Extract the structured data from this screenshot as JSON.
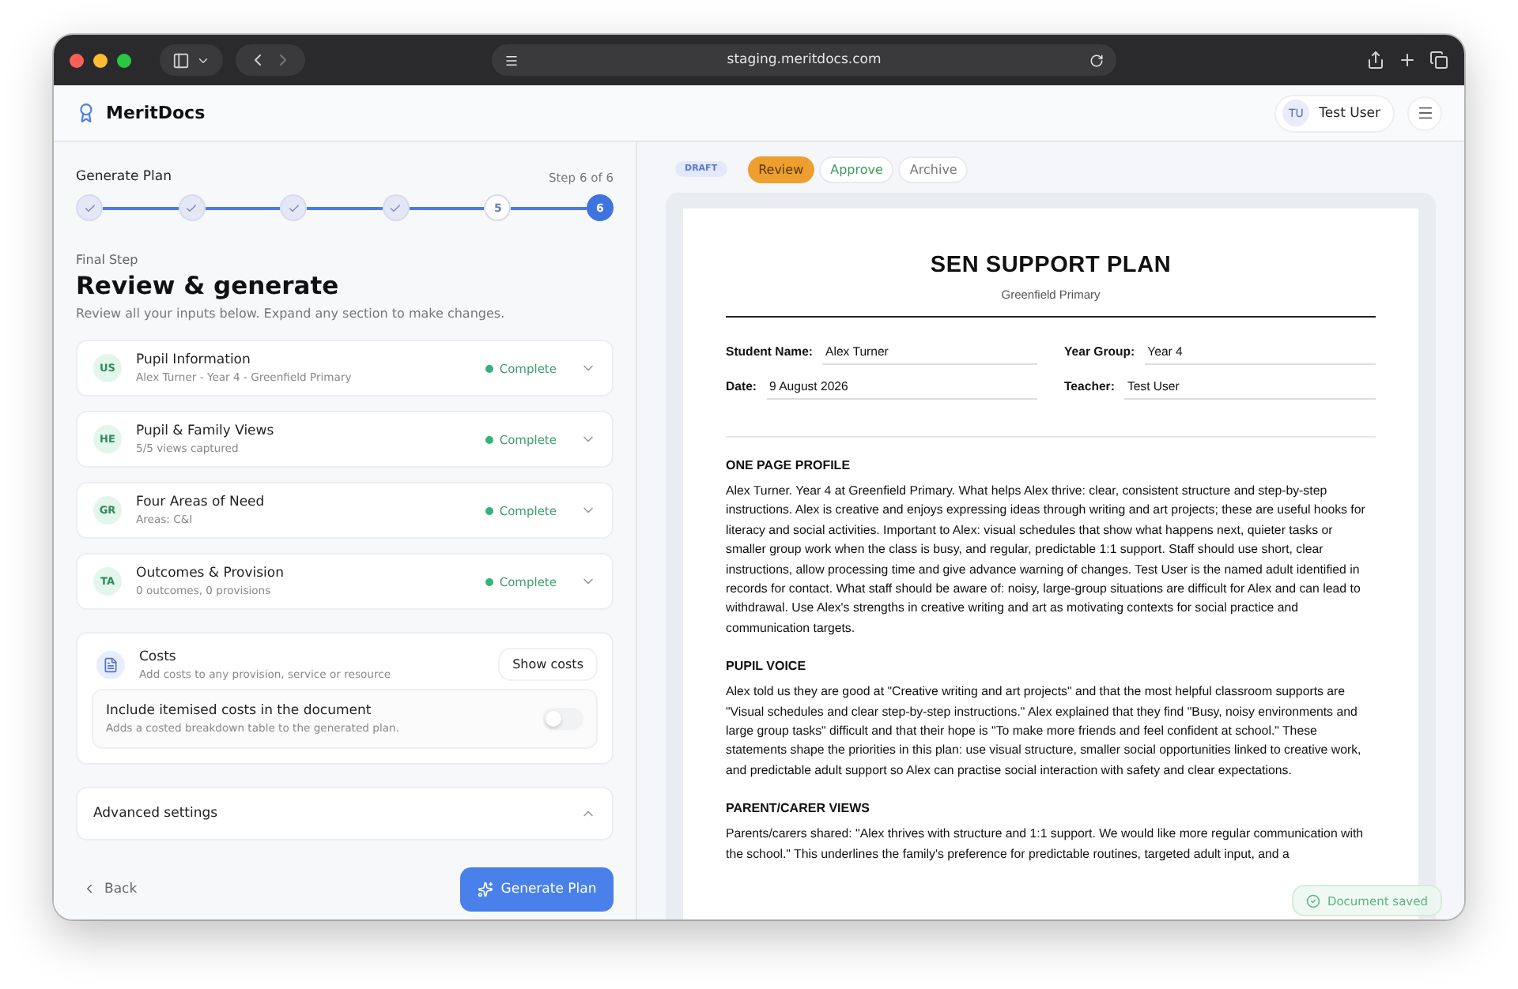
{
  "browser": {
    "url": "staging.meritdocs.com"
  },
  "app": {
    "brand": "MeritDocs",
    "user": {
      "initials": "TU",
      "name": "Test User"
    }
  },
  "wizard": {
    "title": "Generate Plan",
    "step_label": "Step 6 of 6",
    "steps": [
      {
        "done": true,
        "current": false
      },
      {
        "done": true,
        "current": false
      },
      {
        "done": true,
        "current": false
      },
      {
        "done": true,
        "current": false
      },
      {
        "done": false,
        "current": false,
        "label": "5"
      },
      {
        "done": false,
        "current": true,
        "label": "6"
      }
    ],
    "eyebrow": "Final Step",
    "heading": "Review & generate",
    "description": "Review all your inputs below. Expand any section to make changes.",
    "sections": [
      {
        "initials": "US",
        "title": "Pupil Information",
        "subtitle": "Alex Turner - Year 4 - Greenfield Primary",
        "status": "Complete",
        "color": "#34b37a",
        "expanded": false
      },
      {
        "initials": "HE",
        "title": "Pupil & Family Views",
        "subtitle": "5/5 views captured",
        "status": "Complete",
        "color": "#34b37a",
        "expanded": false
      },
      {
        "initials": "GR",
        "title": "Four Areas of Need",
        "subtitle": "Areas: C&I",
        "status": "Complete",
        "color": "#34b37a",
        "expanded": false
      },
      {
        "initials": "TA",
        "title": "Outcomes & Provision",
        "subtitle": "0 outcomes, 0 provisions",
        "status": "Complete",
        "color": "#34b37a",
        "expanded": false
      }
    ],
    "costs": {
      "title": "Costs",
      "subtitle": "Add costs to any provision, service or resource",
      "button": "Show costs",
      "toggle": {
        "title": "Include itemised costs in the document",
        "subtitle": "Adds a costed breakdown table to the generated plan.",
        "on": false
      }
    },
    "advanced": {
      "title": "Advanced settings",
      "expanded": true
    },
    "back": "Back",
    "generate": "Generate Plan"
  },
  "document": {
    "badge": "DRAFT",
    "workflow": [
      {
        "label": "Review",
        "kind": "review",
        "selected": true
      },
      {
        "label": "Approve",
        "kind": "approve",
        "selected": false
      },
      {
        "label": "Archive",
        "kind": "archive",
        "selected": false
      }
    ],
    "title": "SEN SUPPORT PLAN",
    "school": "Greenfield Primary",
    "fields": [
      {
        "label": "Student Name:",
        "value": "Alex Turner"
      },
      {
        "label": "Year Group:",
        "value": "Year 4"
      },
      {
        "label": "Date:",
        "value": "9 August 2026"
      },
      {
        "label": "Teacher:",
        "value": "Test User"
      }
    ],
    "sections": [
      {
        "heading": "ONE PAGE PROFILE",
        "body": "Alex Turner. Year 4 at Greenfield Primary. What helps Alex thrive: clear, consistent structure and step-by-step instructions. Alex is creative and enjoys expressing ideas through writing and art projects; these are useful hooks for literacy and social activities. Important to Alex: visual schedules that show what happens next, quieter tasks or smaller group work when the class is busy, and regular, predictable 1:1 support. Staff should use short, clear instructions, allow processing time and give advance warning of changes. Test User is the named adult identified in records for contact. What staff should be aware of: noisy, large-group situations are difficult for Alex and can lead to withdrawal. Use Alex's strengths in creative writing and art as motivating contexts for social practice and communication targets."
      },
      {
        "heading": "PUPIL VOICE",
        "body": "Alex told us they are good at \"Creative writing and art projects\" and that the most helpful classroom supports are \"Visual schedules and clear step-by-step instructions.\" Alex explained that they find \"Busy, noisy environments and large group tasks\" difficult and that their hope is \"To make more friends and feel confident at school.\" These statements shape the priorities in this plan: use visual structure, smaller social opportunities linked to creative work, and predictable adult support so Alex can practise social interaction with safety and clear expectations."
      },
      {
        "heading": "PARENT/CARER VIEWS",
        "body": "Parents/carers shared: \"Alex thrives with structure and 1:1 support. We would like more regular communication with the school.\" This underlines the family's preference for predictable routines, targeted adult input, and a"
      }
    ]
  },
  "toast": "Document saved"
}
